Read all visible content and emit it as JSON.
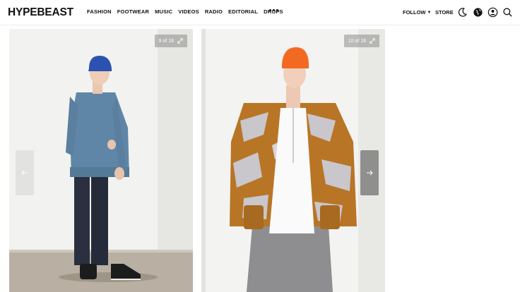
{
  "header": {
    "logo": "HYPEBEAST",
    "nav": [
      "FASHION",
      "FOOTWEAR",
      "MUSIC",
      "VIDEOS",
      "RADIO",
      "EDITORIAL",
      "DROPS"
    ],
    "follow_label": "FOLLOW",
    "store_label": "STORE",
    "icons": [
      "more-icon",
      "chevron-down-icon",
      "moon-icon",
      "globe-icon",
      "account-icon",
      "search-icon"
    ]
  },
  "gallery": {
    "slides": [
      {
        "counter": "9 of 18"
      },
      {
        "counter": "10 of 18"
      }
    ],
    "colors": {
      "backdrop": "#f1f1ef",
      "floor": "#b9b0a3",
      "cardigan": "#5f86a6",
      "beanie_blue": "#2b52b0",
      "beanie_orange": "#f26a22",
      "camo_orange": "#b87526",
      "camo_grey": "#c9c6cc",
      "trousers_grey": "#8e8e90",
      "trousers_navy": "#2a3040"
    }
  }
}
